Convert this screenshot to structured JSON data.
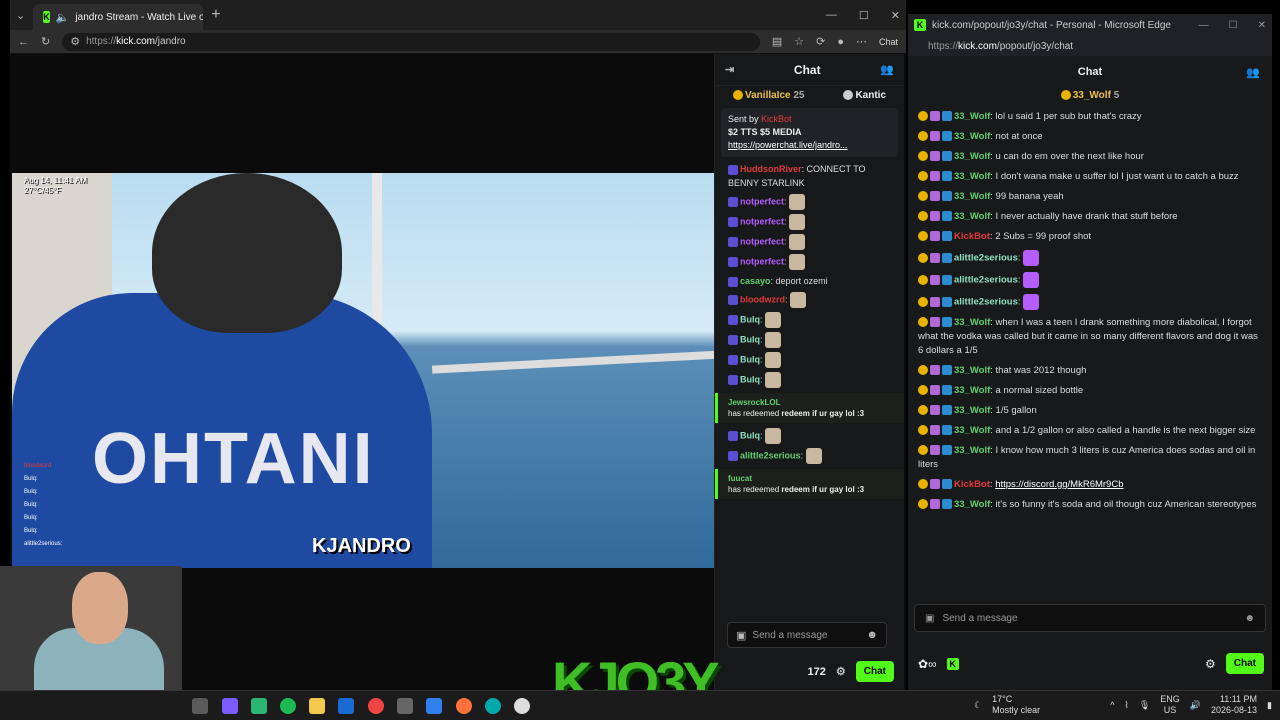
{
  "browser": {
    "tab_title": "jandro Stream - Watch Live o",
    "url_prefix": "https://",
    "url_host": "kick.com",
    "url_path": "/jandro",
    "chat_button": "Chat"
  },
  "video": {
    "timestamp": "Aug 14, 11:41 AM",
    "weather": "27°C/45°F",
    "shirt_text": "OHTANI",
    "brand_text": "JANDRO",
    "overlay_name": "bloodwzrd",
    "overlay_lines": [
      "Bulq:",
      "Bulq:",
      "Bulq:",
      "Bulq:",
      "Bulq:",
      "alittle2serious:"
    ]
  },
  "big_logo": "KJO3Y",
  "left_chat": {
    "title": "Chat",
    "leaders": [
      {
        "rank": "1",
        "name": "VanillaIce",
        "count": "25"
      },
      {
        "rank": "2",
        "name": "Kantic",
        "count": ""
      }
    ],
    "pinned": {
      "sent_by": "Sent by",
      "sender": "KickBot",
      "line1": "$2 TTS $5 MEDIA",
      "link": "https://powerchat.live/jandro..."
    },
    "messages": [
      {
        "user": "HuddsonRiver",
        "color": "u-red",
        "text": "CONNECT TO BENNY STARLINK"
      },
      {
        "user": "notperfect",
        "color": "u-purple",
        "text": ""
      },
      {
        "user": "notperfect",
        "color": "u-purple",
        "text": ""
      },
      {
        "user": "notperfect",
        "color": "u-purple",
        "text": ""
      },
      {
        "user": "notperfect",
        "color": "u-purple",
        "text": ""
      },
      {
        "user": "casayo",
        "color": "u-green",
        "text": "deport ozemi"
      },
      {
        "user": "bloodwzrd",
        "color": "u-red",
        "text": ""
      },
      {
        "user": "Bulq",
        "color": "u-teal",
        "text": ""
      },
      {
        "user": "Bulq",
        "color": "u-teal",
        "text": ""
      },
      {
        "user": "Bulq",
        "color": "u-teal",
        "text": ""
      },
      {
        "user": "Bulq",
        "color": "u-teal",
        "text": ""
      }
    ],
    "redeem1": {
      "user": "JewsrockLOL",
      "text": "has redeemed",
      "reward": "redeem if ur gay lol :3"
    },
    "after_msgs": [
      {
        "user": "Bulq",
        "color": "u-teal"
      },
      {
        "user": "alittle2serious",
        "color": "u-green"
      }
    ],
    "redeem2": {
      "user": "fuucat",
      "text": "has redeemed",
      "reward": "redeem if ur gay lol :3"
    },
    "input_placeholder": "Send a message",
    "viewer_count": "172",
    "chat_button": "Chat"
  },
  "popout": {
    "window_title": "kick.com/popout/jo3y/chat - Personal - Microsoft Edge",
    "url_prefix": "https://",
    "url_host": "kick.com",
    "url_path": "/popout/jo3y/chat",
    "chat_title": "Chat",
    "leader": {
      "rank": "1",
      "name": "33_Wolf",
      "count": "5"
    },
    "messages": [
      {
        "user": "33_Wolf",
        "color": "u-green",
        "text": "lol u said 1 per sub but that's crazy"
      },
      {
        "user": "33_Wolf",
        "color": "u-green",
        "text": "not at once"
      },
      {
        "user": "33_Wolf",
        "color": "u-green",
        "text": "u can do em over the next like hour"
      },
      {
        "user": "33_Wolf",
        "color": "u-green",
        "text": "I don't wana make u suffer lol I just want u to catch a buzz"
      },
      {
        "user": "33_Wolf",
        "color": "u-green",
        "text": "99 banana yeah"
      },
      {
        "user": "33_Wolf",
        "color": "u-green",
        "text": "I never actually have drank that stuff before"
      },
      {
        "user": "KickBot",
        "color": "u-red",
        "text": "2 Subs = 99 proof shot"
      },
      {
        "user": "alittle2serious",
        "color": "u-teal",
        "text": ""
      },
      {
        "user": "alittle2serious",
        "color": "u-teal",
        "text": ""
      },
      {
        "user": "alittle2serious",
        "color": "u-teal",
        "text": ""
      },
      {
        "user": "33_Wolf",
        "color": "u-green",
        "text": "when I was a teen I drank something more diabolical, I forgot what the vodka was called but it came in so many different flavors and dog it was 6 dollars a 1/5"
      },
      {
        "user": "33_Wolf",
        "color": "u-green",
        "text": "that was 2012 though"
      },
      {
        "user": "33_Wolf",
        "color": "u-green",
        "text": "a normal sized bottle"
      },
      {
        "user": "33_Wolf",
        "color": "u-green",
        "text": "1/5 gallon"
      },
      {
        "user": "33_Wolf",
        "color": "u-green",
        "text": "and a 1/2 gallon or also called a handle is the next bigger size"
      },
      {
        "user": "33_Wolf",
        "color": "u-green",
        "text": "I know how much 3 liters is cuz America does sodas and oil in liters"
      },
      {
        "user": "KickBot",
        "color": "u-red",
        "text": "https://discord.gg/MkR6Mr9Cb"
      },
      {
        "user": "33_Wolf",
        "color": "u-green",
        "text": "it's so funny it's soda and oil though cuz American stereotypes"
      }
    ],
    "input_placeholder": "Send a message",
    "chat_button": "Chat"
  },
  "taskbar": {
    "temp": "17°C",
    "weather": "Mostly clear",
    "lang1": "ENG",
    "lang2": "US",
    "time": "11:11 PM",
    "date": "2026-08-13"
  }
}
